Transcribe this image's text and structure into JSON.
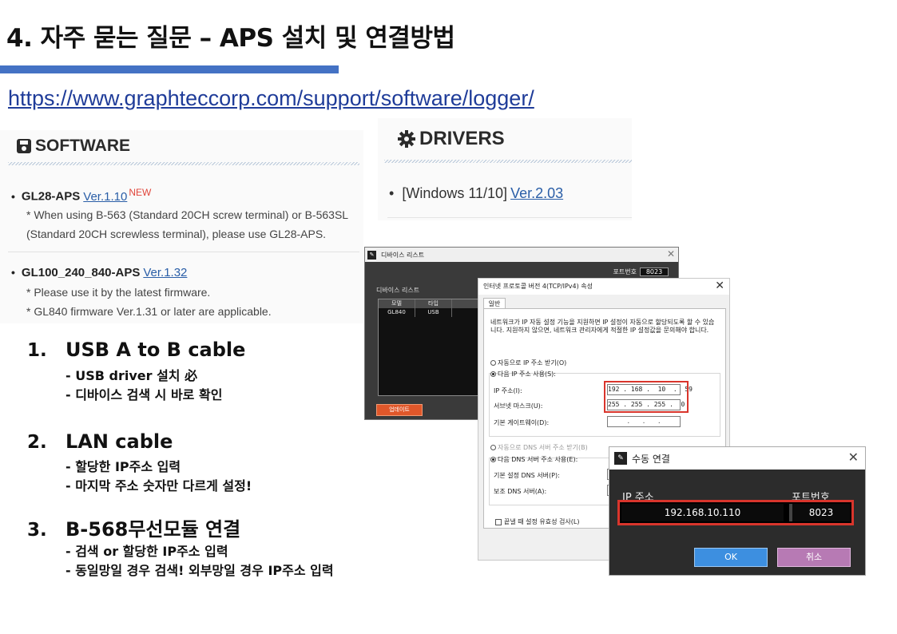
{
  "slide": {
    "title": "4. 자주 묻는 질문 – APS 설치 및 연결방법",
    "url": "https://www.graphteccorp.com/support/software/logger/"
  },
  "software": {
    "heading": "SOFTWARE",
    "items": [
      {
        "bullet": "•",
        "name": "GL28-APS",
        "version": "Ver.1.10",
        "badge": "NEW",
        "notes": [
          "* When using B-563 (Standard 20CH screw terminal) or B-563SL",
          "(Standard 20CH screwless terminal), please use GL28-APS."
        ]
      },
      {
        "bullet": "•",
        "name": "GL100_240_840-APS",
        "version": "Ver.1.32",
        "notes": [
          "* Please use it by the latest firmware.",
          "* GL840 firmware Ver.1.31 or later are applicable."
        ]
      }
    ]
  },
  "drivers": {
    "heading": "DRIVERS",
    "item": {
      "bullet": "•",
      "label": "[Windows 11/10]",
      "version": "Ver.2.03"
    }
  },
  "steps": [
    {
      "num": "1.",
      "title": "USB A to B cable",
      "subs": [
        "- USB driver 설치 必",
        "- 디바이스 검색 시 바로 확인"
      ]
    },
    {
      "num": "2.",
      "title": "LAN cable",
      "subs": [
        "- 할당한 IP주소 입력",
        "- 마지막 주소 숫자만 다르게 설정!"
      ]
    },
    {
      "num": "3.",
      "title": "B-568무선모듈 연결",
      "subs": [
        "- 검색 or 할당한 IP주소 입력",
        "- 동일망일 경우 검색! 외부망일 경우 IP주소 입력"
      ]
    }
  ],
  "device_window": {
    "title": "디바이스 리스트",
    "app_icon": "graphtec-logo-icon",
    "port_label": "포트번호",
    "port_value": "8023",
    "list_label": "디바이스 리스트",
    "columns": [
      "모델",
      "타입"
    ],
    "rows": [
      [
        "GL840",
        "USB"
      ]
    ],
    "update_button": "업데이트"
  },
  "ip_dialog": {
    "title": "인터넷 프로토콜 버전 4(TCP/IPv4) 속성",
    "tab": "일반",
    "description": "네트워크가 IP 자동 설정 기능을 지원하면 IP 설정이 자동으로 할당되도록 할 수 있습니다. 지원하지 않으면, 네트워크 관리자에게 적절한 IP 설정값을 문의해야 합니다.",
    "auto_ip": "자동으로 IP 주소 받기(O)",
    "manual_ip": "다음 IP 주소 사용(S):",
    "ip_label": "IP 주소(I):",
    "ip_value": "192 . 168 .  10  .  59",
    "mask_label": "서브넷 마스크(U):",
    "mask_value": "255 . 255 . 255 .  0",
    "gateway_label": "기본 게이트웨이(D):",
    "gateway_value": "  .   .   .  ",
    "auto_dns": "자동으로 DNS 서버 주소 받기(B)",
    "manual_dns": "다음 DNS 서버 주소 사용(E):",
    "dns1_label": "기본 설정 DNS 서버(P):",
    "dns2_label": "보조 DNS 서버(A):",
    "validate_label": "끝낼 때 설정 유효성 검사(L)"
  },
  "manual_connect": {
    "title": "수동 연결",
    "app_icon": "graphtec-logo-icon",
    "ip_label": "IP 주소",
    "port_label": "포트번호",
    "ip_value": "192.168.10.110",
    "port_value": "8023",
    "ok": "OK",
    "cancel": "취소"
  }
}
